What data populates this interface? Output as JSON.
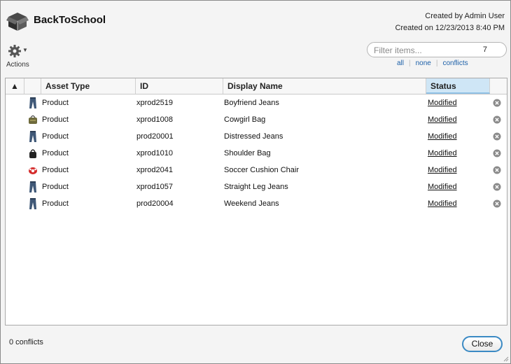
{
  "dialog": {
    "title": "BackToSchool",
    "created_by": "Created by Admin User",
    "created_on": "Created on 12/23/2013 8:40 PM",
    "actions_label": "Actions",
    "filter": {
      "placeholder": "Filter items...",
      "count": "7",
      "links": [
        "all",
        "none",
        "conflicts"
      ]
    }
  },
  "table": {
    "sort_indicator": "▲",
    "columns": [
      "Asset Type",
      "ID",
      "Display Name",
      "Status"
    ],
    "sorted_column": "Status",
    "rows": [
      {
        "icon": "jeans-icon",
        "type": "Product",
        "id": "xprod2519",
        "name": "Boyfriend Jeans",
        "status": "Modified"
      },
      {
        "icon": "bag-icon",
        "type": "Product",
        "id": "xprod1008",
        "name": "Cowgirl Bag",
        "status": "Modified"
      },
      {
        "icon": "jeans-icon",
        "type": "Product",
        "id": "prod20001",
        "name": "Distressed Jeans",
        "status": "Modified"
      },
      {
        "icon": "shoulder-bag-icon",
        "type": "Product",
        "id": "xprod1010",
        "name": "Shoulder Bag",
        "status": "Modified"
      },
      {
        "icon": "chair-icon",
        "type": "Product",
        "id": "xprod2041",
        "name": "Soccer Cushion Chair",
        "status": "Modified"
      },
      {
        "icon": "jeans-icon",
        "type": "Product",
        "id": "xprod1057",
        "name": "Straight Leg Jeans",
        "status": "Modified"
      },
      {
        "icon": "jeans-icon",
        "type": "Product",
        "id": "prod20004",
        "name": "Weekend Jeans",
        "status": "Modified"
      }
    ]
  },
  "footer": {
    "conflicts": "0 conflicts",
    "close_label": "Close"
  },
  "colors": {
    "accent": "#3b8ac4",
    "sorted_header": "#cfe6f6",
    "link": "#1b5fa8"
  }
}
